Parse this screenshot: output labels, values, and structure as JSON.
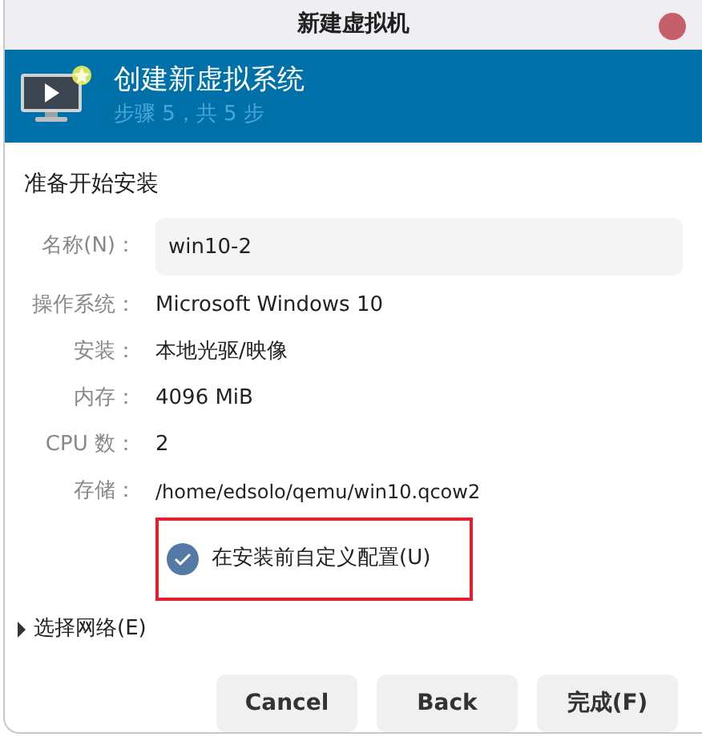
{
  "window": {
    "title": "新建虚拟机"
  },
  "banner": {
    "title": "创建新虚拟系统",
    "subtitle": "步骤 5，共 5 步"
  },
  "section_title": "准备开始安装",
  "name_field": {
    "label": "名称(N)：",
    "value": "win10-2"
  },
  "details": [
    {
      "label": "操作系统：",
      "value": "Microsoft Windows 10"
    },
    {
      "label": "安装：",
      "value": "本地光驱/映像"
    },
    {
      "label": "内存：",
      "value": "4096 MiB"
    },
    {
      "label": "CPU 数：",
      "value": "2"
    },
    {
      "label": "存储：",
      "value": "/home/edsolo/qemu/win10.qcow2"
    }
  ],
  "customize_checkbox": {
    "label": "在安装前自定义配置(U)",
    "checked": true,
    "highlighted": true
  },
  "network_expander": {
    "label": "选择网络(E)",
    "expanded": false
  },
  "buttons": [
    "Cancel",
    "Back",
    "完成(F)"
  ]
}
